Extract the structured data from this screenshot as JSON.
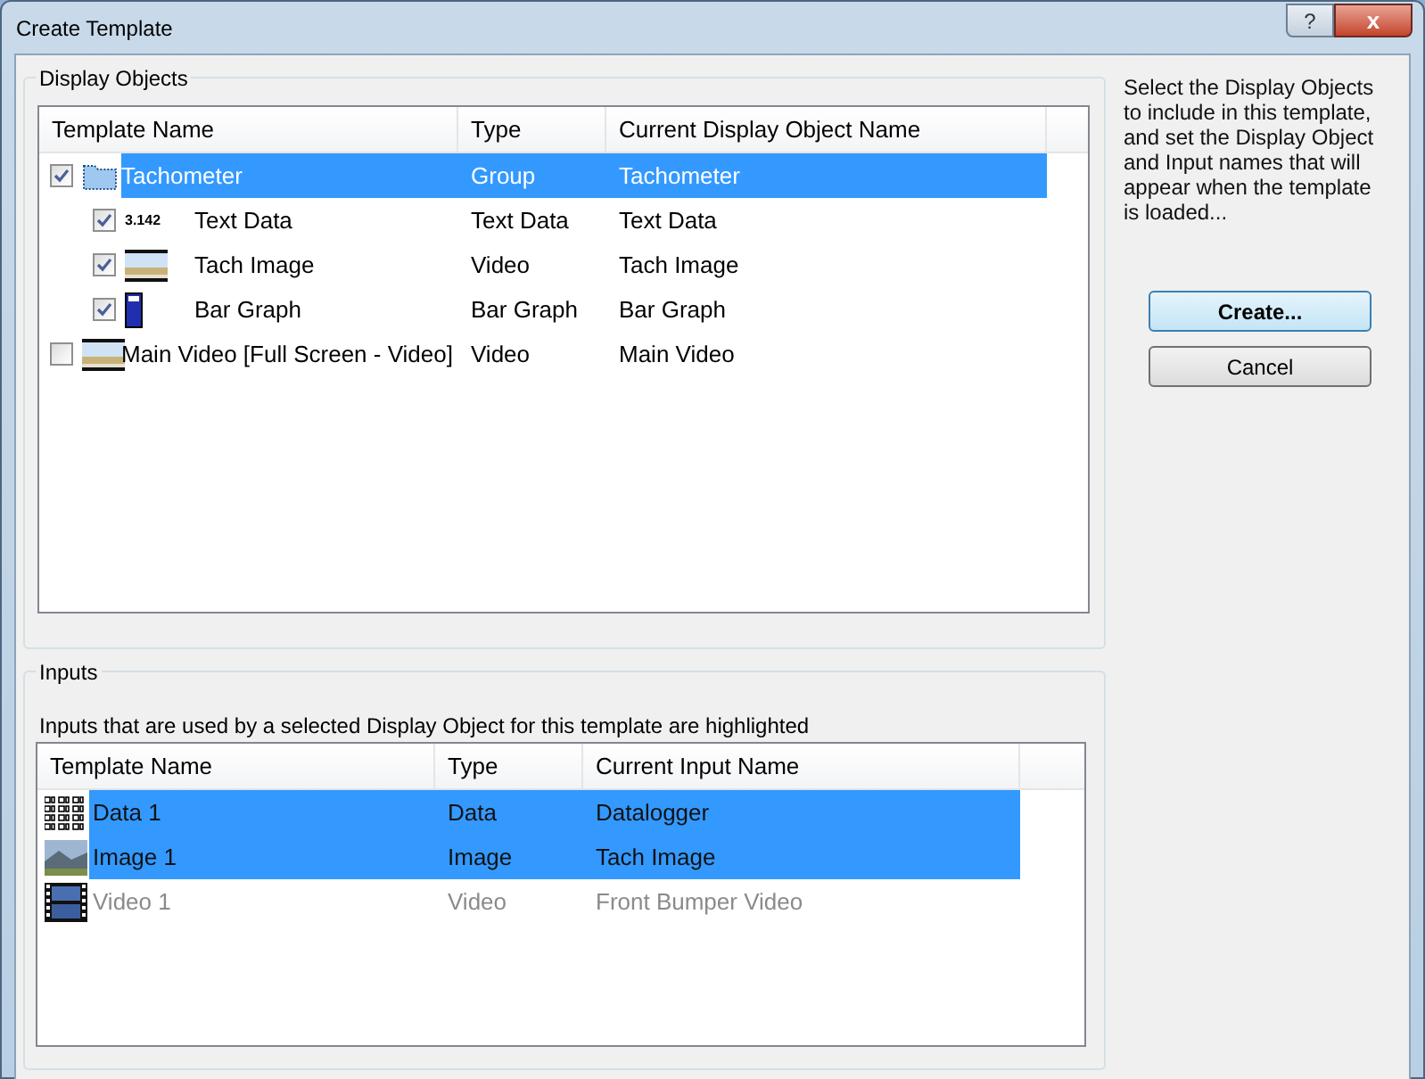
{
  "window": {
    "title": "Create Template",
    "help_button": "?",
    "close_button": "x"
  },
  "display_objects": {
    "title": "Display Objects",
    "columns": [
      "Template Name",
      "Type",
      "Current Display Object Name"
    ],
    "rows": [
      {
        "name": "Tachometer",
        "kind": "group",
        "type": "Group",
        "current": "Tachometer",
        "checked": true,
        "selected": true,
        "children": [
          {
            "name": "Text Data",
            "kind": "text",
            "icon_text": "3.142",
            "type": "Text Data",
            "current": "Text Data",
            "checked": true,
            "selected": false
          },
          {
            "name": "Tach Image",
            "kind": "image",
            "type": "Video",
            "current": "Tach Image",
            "checked": true,
            "selected": false
          },
          {
            "name": "Bar Graph",
            "kind": "bar",
            "type": "Bar Graph",
            "current": "Bar Graph",
            "checked": true,
            "selected": false
          }
        ]
      },
      {
        "name": "Main Video [Full Screen - Video]",
        "kind": "image",
        "type": "Video",
        "current": "Main Video",
        "checked": false,
        "selected": false
      }
    ]
  },
  "help_text": "Select the Display Objects to include in this template, and set the Display Object and Input names that will appear when the template is loaded...",
  "buttons": [
    {
      "label": "Create...",
      "default": true
    },
    {
      "label": "Cancel",
      "default": false
    }
  ],
  "inputs": {
    "title": "Inputs",
    "caption": "Inputs that are used by a selected Display Object for this template are highlighted",
    "columns": [
      "Template Name",
      "Type",
      "Current Input Name"
    ],
    "rows": [
      {
        "name": "Data 1",
        "kind": "data",
        "type": "Data",
        "current": "Datalogger",
        "selected": true,
        "disabled": false
      },
      {
        "name": "Image 1",
        "kind": "photo",
        "type": "Image",
        "current": "Tach Image",
        "selected": true,
        "disabled": false
      },
      {
        "name": "Video 1",
        "kind": "film",
        "type": "Video",
        "current": "Front Bumper Video",
        "selected": false,
        "disabled": true
      }
    ]
  }
}
